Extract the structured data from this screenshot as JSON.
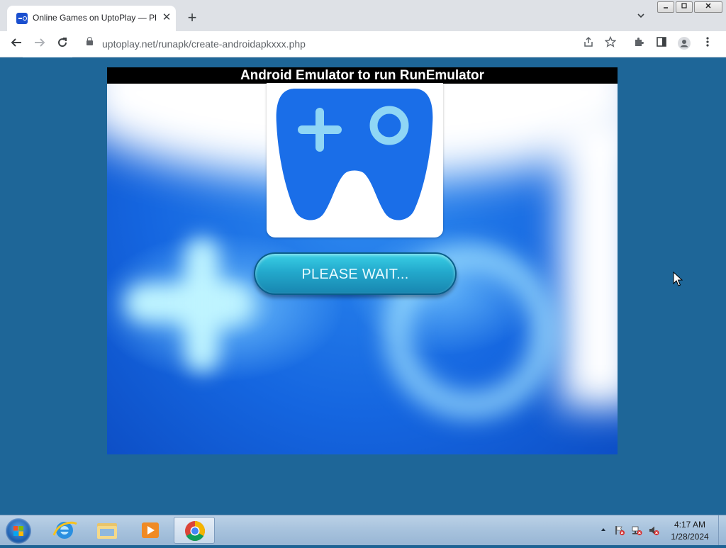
{
  "browser": {
    "tab_title": "Online Games on UptoPlay — Pl",
    "tab_close": "✕",
    "new_tab": "+",
    "url": "uptoplay.net/runapk/create-androidapkxxx.php",
    "icons": [
      "back-arrow-icon",
      "forward-arrow-icon",
      "reload-icon",
      "lock-icon",
      "share-icon",
      "star-icon",
      "extensions-puzzle-icon",
      "side-panel-icon",
      "profile-icon",
      "kebab-menu-icon",
      "tab-search-icon"
    ]
  },
  "page": {
    "banner_title": "Android Emulator to run RunEmulator",
    "wait_button": "PLEASE WAIT...",
    "colors": {
      "page_bg": "#1e6698",
      "logo_blue": "#1a6ee8",
      "logo_accent": "#8fd6f5",
      "button": "#23a9cc"
    }
  },
  "taskbar": {
    "apps": [
      "start-orb",
      "internet-explorer-icon",
      "file-explorer-icon",
      "media-player-icon",
      "chrome-icon"
    ],
    "time": "4:17 AM",
    "date": "1/28/2024"
  }
}
